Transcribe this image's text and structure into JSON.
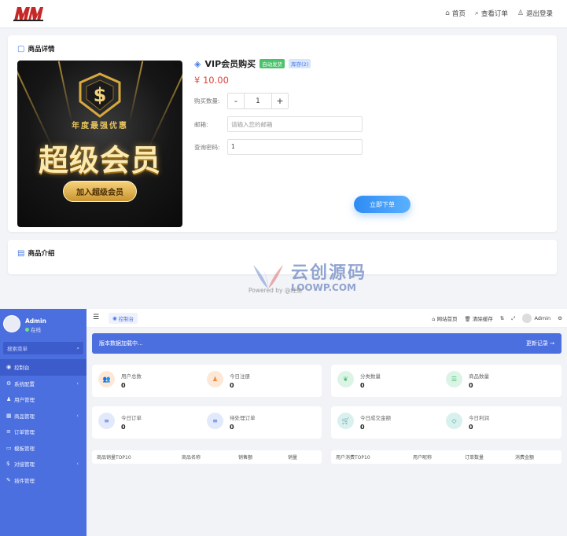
{
  "shop": {
    "nav": [
      {
        "icon": "home-icon",
        "label": "首页"
      },
      {
        "icon": "search-icon",
        "label": "查看订单"
      },
      {
        "icon": "user-icon",
        "label": "退出登录"
      }
    ],
    "detail_title": "商品详情",
    "promo": {
      "sub": "年度最强优惠",
      "big": "超级会员",
      "button": "加入超级会员"
    },
    "product": {
      "name": "VIP会员购买",
      "tag_auto": "自动发货",
      "tag_stock": "库存(2)",
      "price": "¥ 10.00"
    },
    "form": {
      "qty_label": "购买数量:",
      "qty_minus": "-",
      "qty_value": "1",
      "qty_plus": "+",
      "email_label": "邮箱:",
      "email_placeholder": "请输入您的邮箱",
      "pwd_label": "查询密码:",
      "pwd_value": "1",
      "buy_button": "立即下单"
    },
    "intro_title": "商品介绍",
    "powered": "Powered by @红鱼",
    "watermark": {
      "cn": "云创源码",
      "en": "LOOWP.COM"
    }
  },
  "admin": {
    "user": {
      "name": "Admin",
      "status": "在线"
    },
    "search_placeholder": "搜索菜单",
    "menu": [
      {
        "icon": "dashboard-icon",
        "label": "控制台",
        "active": true,
        "arrow": ""
      },
      {
        "icon": "gear-icon",
        "label": "系统配置",
        "active": false,
        "arrow": "‹"
      },
      {
        "icon": "user-icon",
        "label": "用户管理",
        "active": false,
        "arrow": ""
      },
      {
        "icon": "goods-icon",
        "label": "商品管理",
        "active": false,
        "arrow": "‹"
      },
      {
        "icon": "order-icon",
        "label": "订单管理",
        "active": false,
        "arrow": ""
      },
      {
        "icon": "template-icon",
        "label": "模板管理",
        "active": false,
        "arrow": ""
      },
      {
        "icon": "pay-icon",
        "label": "对接管理",
        "active": false,
        "arrow": "‹"
      },
      {
        "icon": "plugin-icon",
        "label": "插件管理",
        "active": false,
        "arrow": ""
      }
    ],
    "topbar": {
      "tab": "控制台",
      "site_home": "网站首页",
      "clear_cache": "清除缓存",
      "user": "Admin"
    },
    "notice": {
      "text": "版本数据加载中...",
      "link": "更新记录 →"
    },
    "stats": [
      {
        "label": "用户总数",
        "value": "0",
        "icon": "users-icon",
        "color": "#f08a3c",
        "bg": "#fde8d8"
      },
      {
        "label": "今日注册",
        "value": "0",
        "icon": "user-add-icon",
        "color": "#f08a3c",
        "bg": "#fde8d8"
      },
      {
        "label": "分类数量",
        "value": "0",
        "icon": "leaf-icon",
        "color": "#3fbf6e",
        "bg": "#dcf4e5"
      },
      {
        "label": "商品数量",
        "value": "0",
        "icon": "list-icon",
        "color": "#3fbf6e",
        "bg": "#dcf4e5"
      },
      {
        "label": "今日订单",
        "value": "0",
        "icon": "menu-icon",
        "color": "#4c6fe0",
        "bg": "#e2e9fb"
      },
      {
        "label": "待处理订单",
        "value": "0",
        "icon": "menu-icon",
        "color": "#4c6fe0",
        "bg": "#e2e9fb"
      },
      {
        "label": "今日成交金额",
        "value": "0",
        "icon": "cart-icon",
        "color": "#2aa79b",
        "bg": "#d8f1ee"
      },
      {
        "label": "今日利润",
        "value": "0",
        "icon": "diamond-icon",
        "color": "#2aa79b",
        "bg": "#d8f1ee"
      }
    ],
    "table_left": [
      "商品销量TOP10",
      "商品名称",
      "销售额",
      "销量"
    ],
    "table_right": [
      "用户消费TOP10",
      "用户昵称",
      "订单数量",
      "消费金额"
    ]
  }
}
